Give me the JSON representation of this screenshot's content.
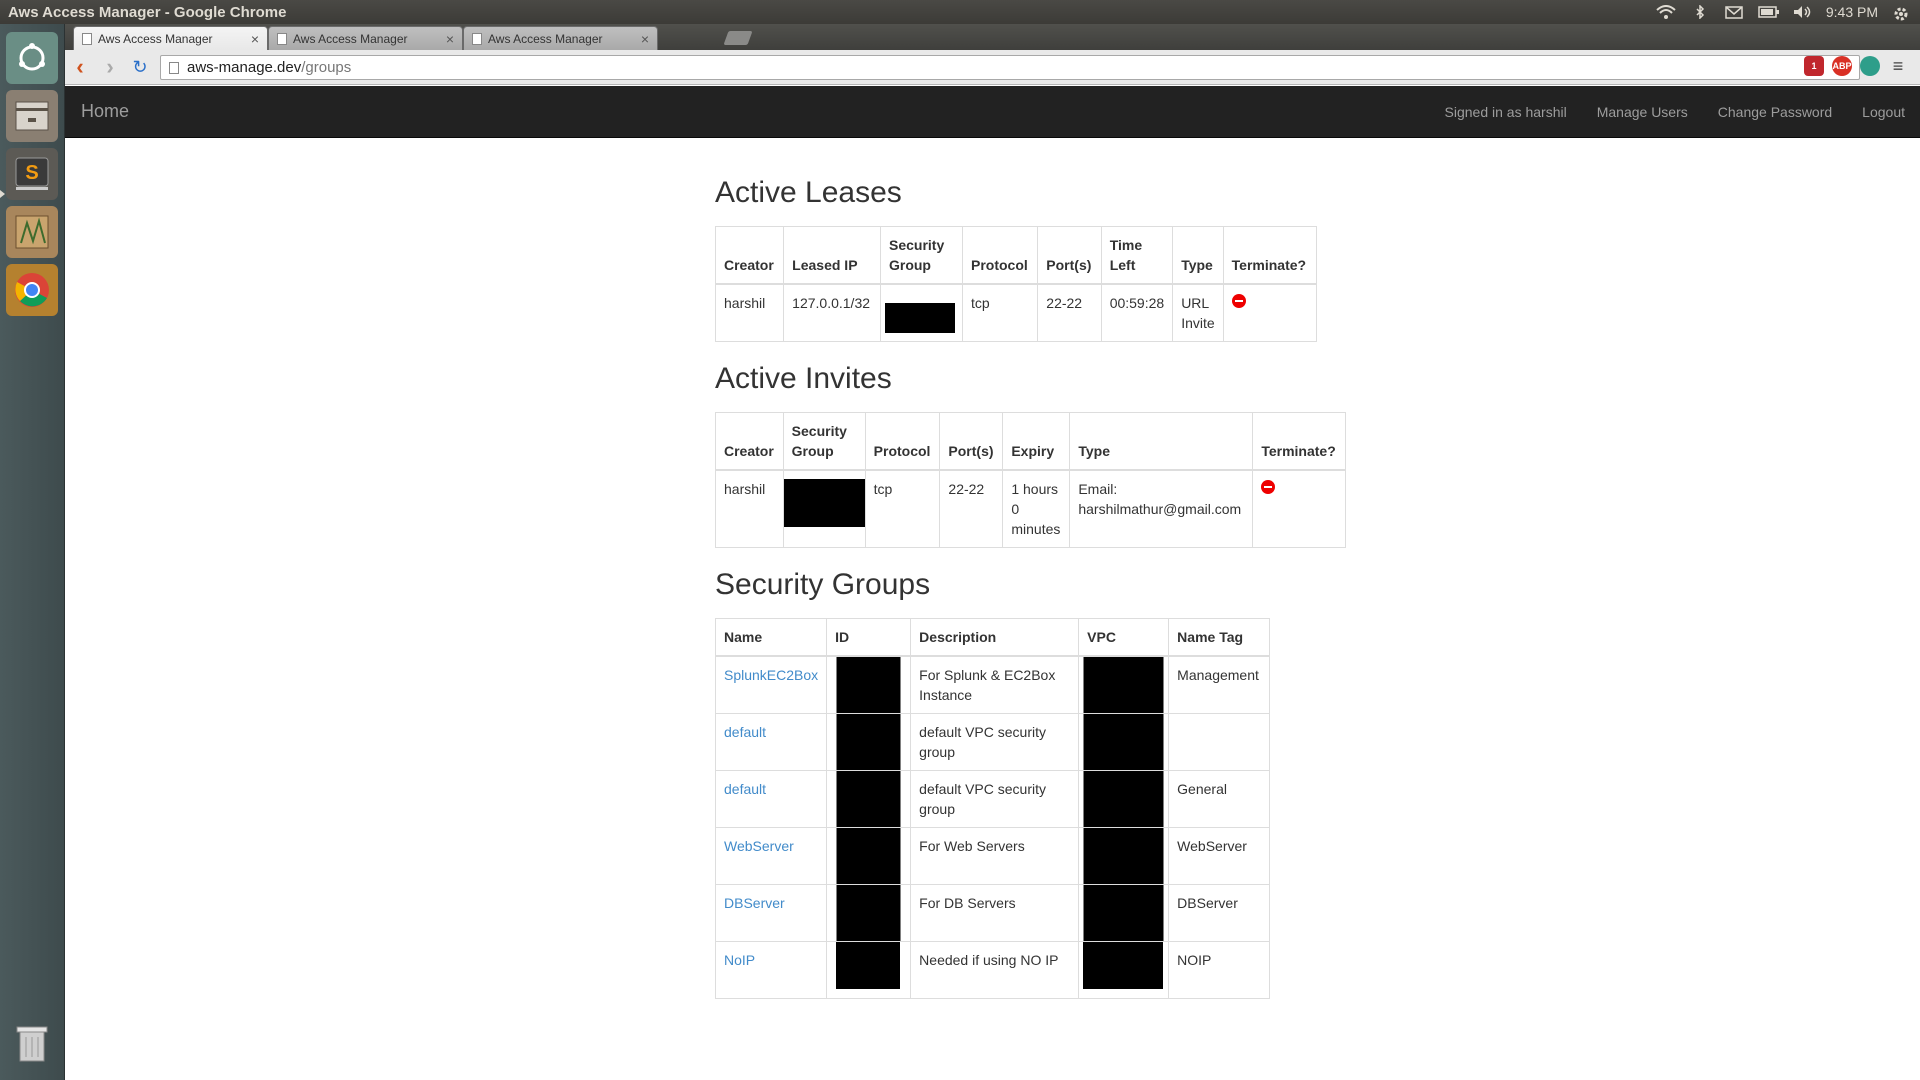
{
  "window": {
    "title": "Aws Access Manager - Google Chrome"
  },
  "tray": {
    "time": "9:43 PM"
  },
  "tabs": [
    {
      "label": "Aws Access Manager",
      "close": "×",
      "active": true
    },
    {
      "label": "Aws Access Manager",
      "close": "×",
      "active": false
    },
    {
      "label": "Aws Access Manager",
      "close": "×",
      "active": false
    }
  ],
  "toolbar": {
    "back": "‹",
    "forward": "›",
    "reload": "↻",
    "url_host": "aws-manage.dev",
    "url_path": "/groups",
    "star": "☆",
    "menu": "≡",
    "ext_badge": "1",
    "ext_abp": "ABP"
  },
  "navbar": {
    "brand": "Home",
    "signed_in": "Signed in as harshil",
    "manage_users": "Manage Users",
    "change_password": "Change Password",
    "logout": "Logout"
  },
  "leases": {
    "title": "Active Leases",
    "headers": [
      "Creator",
      "Leased IP",
      "Security Group",
      "Protocol",
      "Port(s)",
      "Time Left",
      "Type",
      "Terminate?"
    ],
    "rows": [
      {
        "creator": "harshil",
        "ip": "127.0.0.1/32",
        "protocol": "tcp",
        "ports": "22-22",
        "time_left": "00:59:28",
        "type": "URL Invite"
      }
    ]
  },
  "invites": {
    "title": "Active Invites",
    "headers": [
      "Creator",
      "Security Group",
      "Protocol",
      "Port(s)",
      "Expiry",
      "Type",
      "Terminate?"
    ],
    "rows": [
      {
        "creator": "harshil",
        "protocol": "tcp",
        "ports": "22-22",
        "expiry": "1 hours 0 minutes",
        "type": "Email: harshilmathur@gmail.com"
      }
    ]
  },
  "groups": {
    "title": "Security Groups",
    "headers": [
      "Name",
      "ID",
      "Description",
      "VPC",
      "Name Tag"
    ],
    "rows": [
      {
        "name": "SplunkEC2Box",
        "description": "For Splunk & EC2Box Instance",
        "tag": "Management"
      },
      {
        "name": "default",
        "description": "default VPC security group",
        "tag": ""
      },
      {
        "name": "default",
        "description": "default VPC security group",
        "tag": "General"
      },
      {
        "name": "WebServer",
        "description": "For Web Servers",
        "tag": "WebServer"
      },
      {
        "name": "DBServer",
        "description": "For DB Servers",
        "tag": "DBServer"
      },
      {
        "name": "NoIP",
        "description": "Needed if using NO IP",
        "tag": "NOIP"
      }
    ]
  }
}
